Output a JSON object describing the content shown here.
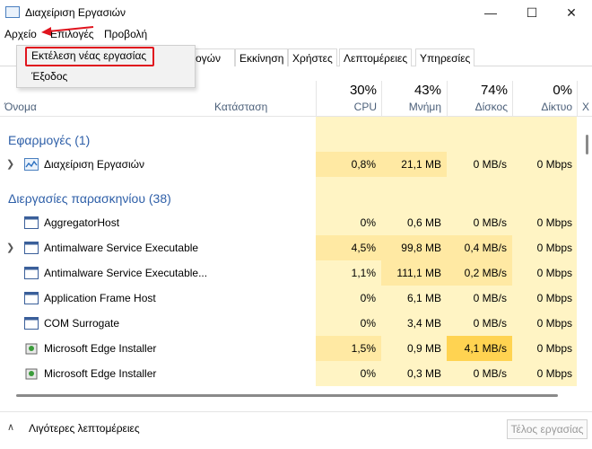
{
  "window": {
    "title": "Διαχείριση Εργασιών",
    "minimize_glyph": "—",
    "maximize_glyph": "☐",
    "close_glyph": "✕"
  },
  "menu": {
    "file": "Αρχείο",
    "options": "Επιλογές",
    "view": "Προβολή"
  },
  "file_menu": {
    "run_new_task": "Εκτέλεση νέας εργασίας",
    "exit": "Έξοδος"
  },
  "tabs": {
    "app_history_partial": "ογών",
    "startup": "Εκκίνηση",
    "users": "Χρήστες",
    "details": "Λεπτομέρειες",
    "services": "Υπηρεσίες"
  },
  "columns": {
    "name": "Όνομα",
    "status": "Κατάσταση",
    "cpu": {
      "pct": "30%",
      "label": "CPU"
    },
    "memory": {
      "pct": "43%",
      "label": "Μνήμη"
    },
    "disk": {
      "pct": "74%",
      "label": "Δίσκος"
    },
    "network": {
      "pct": "0%",
      "label": "Δίκτυο"
    },
    "extra_partial": "Χ"
  },
  "groups": {
    "apps": "Εφαρμογές (1)",
    "background": "Διεργασίες παρασκηνίου (38)"
  },
  "processes": [
    {
      "name": "Διαχείριση Εργασιών",
      "cpu": "0,8%",
      "memory": "21,1 MB",
      "disk": "0 MB/s",
      "network": "0 Mbps",
      "expandable": true,
      "icon": "task-manager-icon"
    },
    {
      "name": "AggregatorHost",
      "cpu": "0%",
      "memory": "0,6 MB",
      "disk": "0 MB/s",
      "network": "0 Mbps",
      "expandable": false,
      "icon": "process-window-icon"
    },
    {
      "name": "Antimalware Service Executable",
      "cpu": "4,5%",
      "memory": "99,8 MB",
      "disk": "0,4 MB/s",
      "network": "0 Mbps",
      "expandable": true,
      "icon": "process-window-icon"
    },
    {
      "name": "Antimalware Service Executable...",
      "cpu": "1,1%",
      "memory": "111,1 MB",
      "disk": "0,2 MB/s",
      "network": "0 Mbps",
      "expandable": false,
      "icon": "process-window-icon"
    },
    {
      "name": "Application Frame Host",
      "cpu": "0%",
      "memory": "6,1 MB",
      "disk": "0 MB/s",
      "network": "0 Mbps",
      "expandable": false,
      "icon": "process-window-icon"
    },
    {
      "name": "COM Surrogate",
      "cpu": "0%",
      "memory": "3,4 MB",
      "disk": "0 MB/s",
      "network": "0 Mbps",
      "expandable": false,
      "icon": "process-window-icon"
    },
    {
      "name": "Microsoft Edge Installer",
      "cpu": "1,5%",
      "memory": "0,9 MB",
      "disk": "4,1 MB/s",
      "network": "0 Mbps",
      "expandable": false,
      "icon": "installer-icon"
    },
    {
      "name": "Microsoft Edge Installer",
      "cpu": "0%",
      "memory": "0,3 MB",
      "disk": "0 MB/s",
      "network": "0 Mbps",
      "expandable": false,
      "icon": "installer-icon"
    }
  ],
  "footer": {
    "fewer_details": "Λιγότερες λεπτομέρειες",
    "end_task": "Τέλος εργασίας"
  },
  "colors": {
    "heat_light": "#fff4c4",
    "heat_medium": "#ffe9a3",
    "heat_high": "#ffd351",
    "group_text": "#2e5fa8",
    "annotation_red": "#e0141e"
  }
}
